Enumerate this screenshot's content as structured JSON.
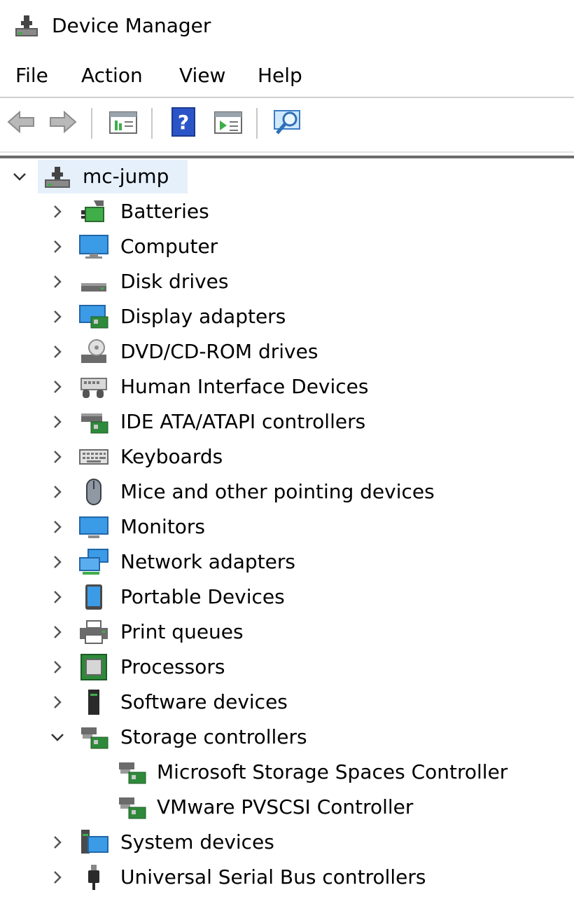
{
  "window": {
    "title": "Device Manager"
  },
  "menu": [
    "File",
    "Action",
    "View",
    "Help"
  ],
  "toolbar": [
    "back-icon",
    "forward-icon",
    "properties-icon",
    "help-icon",
    "update-driver-icon",
    "scan-hardware-icon"
  ],
  "tree": {
    "root": "mc-jump",
    "items": [
      {
        "label": "Batteries",
        "icon": "battery-icon"
      },
      {
        "label": "Computer",
        "icon": "computer-icon"
      },
      {
        "label": "Disk drives",
        "icon": "disk-drive-icon"
      },
      {
        "label": "Display adapters",
        "icon": "display-adapter-icon"
      },
      {
        "label": "DVD/CD-ROM drives",
        "icon": "dvd-drive-icon"
      },
      {
        "label": "Human Interface Devices",
        "icon": "hid-icon"
      },
      {
        "label": "IDE ATA/ATAPI controllers",
        "icon": "ide-controller-icon"
      },
      {
        "label": "Keyboards",
        "icon": "keyboard-icon"
      },
      {
        "label": "Mice and other pointing devices",
        "icon": "mouse-icon"
      },
      {
        "label": "Monitors",
        "icon": "monitor-icon"
      },
      {
        "label": "Network adapters",
        "icon": "network-adapter-icon"
      },
      {
        "label": "Portable Devices",
        "icon": "portable-device-icon"
      },
      {
        "label": "Print queues",
        "icon": "printer-icon"
      },
      {
        "label": "Processors",
        "icon": "processor-icon"
      },
      {
        "label": "Software devices",
        "icon": "software-device-icon"
      },
      {
        "label": "Storage controllers",
        "icon": "storage-controller-icon"
      },
      {
        "label": "System devices",
        "icon": "system-device-icon"
      },
      {
        "label": "Universal Serial Bus controllers",
        "icon": "usb-icon"
      }
    ],
    "storage_children": [
      {
        "label": "Microsoft Storage Spaces Controller",
        "icon": "storage-controller-icon"
      },
      {
        "label": "VMware PVSCSI Controller",
        "icon": "storage-controller-icon"
      }
    ]
  },
  "colors": {
    "selection": "#e5f0fb",
    "accent": "#2b79d0"
  }
}
